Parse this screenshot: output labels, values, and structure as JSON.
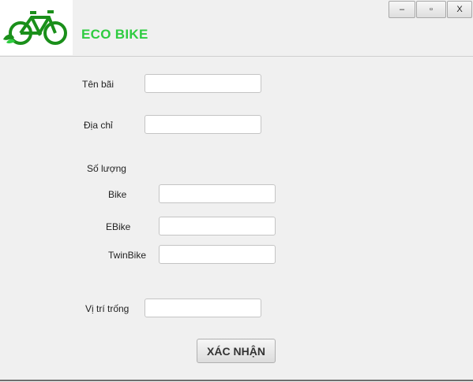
{
  "header": {
    "app_title": "ECO BIKE",
    "logo_icon": "bicycle-icon",
    "logo_color": "#1a8f1a",
    "title_color": "#2ecc40"
  },
  "window_controls": {
    "minimize": "–",
    "maximize": "▫",
    "close": "X"
  },
  "form": {
    "name_label": "Tên bãi",
    "name_value": "",
    "address_label": "Địa chỉ",
    "address_value": "",
    "quantity_label": "Số lượng",
    "bike_label": "Bike",
    "bike_value": "",
    "ebike_label": "EBike",
    "ebike_value": "",
    "twinbike_label": "TwinBike",
    "twinbike_value": "",
    "empty_slots_label": "Vị trí trống",
    "empty_slots_value": "",
    "confirm_label": "XÁC NHẬN"
  }
}
